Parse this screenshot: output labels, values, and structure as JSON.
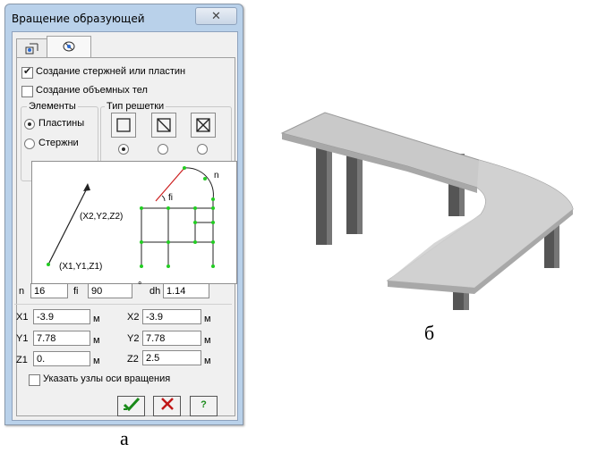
{
  "dialog": {
    "title": "Вращение образующей",
    "close_glyph": "✕",
    "tabs": [
      {
        "icon": "move-nodes-icon"
      },
      {
        "icon": "rotate-icon"
      }
    ],
    "checkbox_bars": {
      "label": "Создание стержней или пластин",
      "checked": true
    },
    "checkbox_solids": {
      "label": "Создание объемных тел",
      "checked": false
    },
    "elements_group": {
      "title": "Элементы",
      "options": [
        {
          "label": "Пластины",
          "selected": true
        },
        {
          "label": "Стержни",
          "selected": false
        }
      ]
    },
    "grid_group": {
      "title": "Тип решетки",
      "options": [
        {
          "icon": "grid-plain-icon",
          "selected": true
        },
        {
          "icon": "grid-diagonal-icon",
          "selected": false
        },
        {
          "icon": "grid-cross-icon",
          "selected": false
        }
      ]
    },
    "scheme": {
      "p2": "(X2,Y2,Z2)",
      "p1": "(X1,Y1,Z1)",
      "n": "n",
      "fi": "fi"
    },
    "params": {
      "n_label": "n",
      "n_value": "16",
      "fi_label": "fi",
      "fi_value": "90",
      "deg": "°",
      "dh_label": "dh",
      "dh_value": "1.14"
    },
    "coords": {
      "x1_label": "X1",
      "x1": "-3.9",
      "y1_label": "Y1",
      "y1": "7.78",
      "z1_label": "Z1",
      "z1": "0.",
      "x2_label": "X2",
      "x2": "-3.9",
      "y2_label": "Y2",
      "y2": "7.78",
      "z2_label": "Z2",
      "z2": "2.5",
      "unit": "м"
    },
    "checkbox_axis_nodes": {
      "label": "Указать узлы оси вращения",
      "checked": false
    },
    "buttons": {
      "ok_icon": "check-icon",
      "cancel_icon": "cross-icon",
      "help_label": "?"
    }
  },
  "captions": {
    "a": "а",
    "b": "б"
  },
  "colors": {
    "ok": "#1a8a1a",
    "cancel": "#c01818",
    "help": "#1a8a1a",
    "node": "#22cc22",
    "arc": "#cc1f1f"
  }
}
